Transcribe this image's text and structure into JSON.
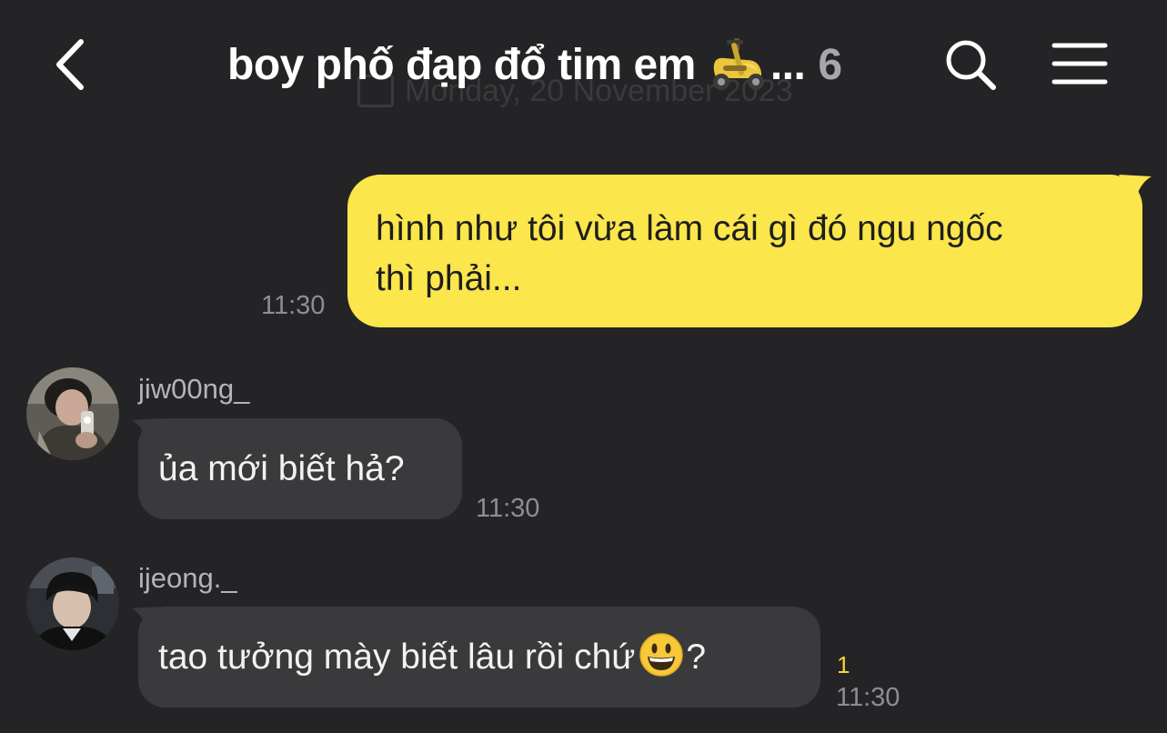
{
  "header": {
    "title": "boy phố đạp đổ tim em",
    "title_emoji": "scooter-emoji",
    "ellipsis": "...",
    "member_count": "6",
    "date_ghost": "Monday, 20 November 2023",
    "icons": {
      "back": "chevron-left-icon",
      "search": "search-icon",
      "menu": "hamburger-menu-icon"
    }
  },
  "messages": [
    {
      "direction": "outgoing",
      "text_line1": "hình như tôi vừa làm cái gì đó ngu ngốc",
      "text_line2": "thì phải...",
      "time": "11:30"
    },
    {
      "direction": "incoming",
      "sender": "jiw00ng_",
      "text": "ủa mới biết hả?",
      "time": "11:30"
    },
    {
      "direction": "incoming",
      "sender": "ijeong._",
      "text": "tao tưởng mày biết lâu rồi chứ",
      "emoji": "smiley-emoji",
      "text_after_emoji": "?",
      "unread_count": "1",
      "time": "11:30"
    }
  ],
  "colors": {
    "background": "#242426",
    "outgoing_bubble": "#fbe64b",
    "incoming_bubble": "#3a3a3c",
    "unread": "#f5d63a",
    "timestamp": "#8e8e92"
  }
}
